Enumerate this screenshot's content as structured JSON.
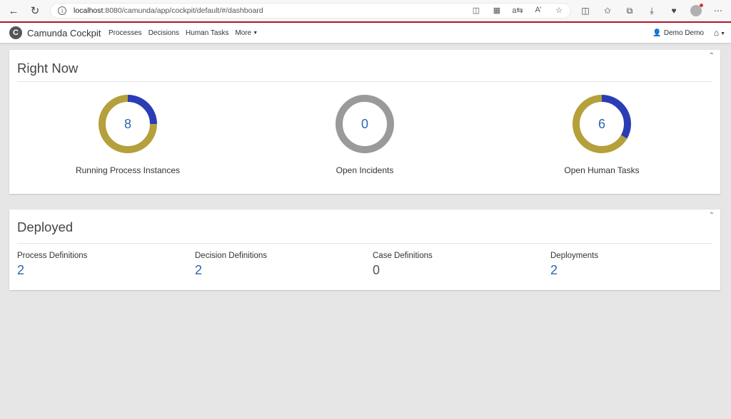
{
  "browser": {
    "url_host": "localhost",
    "url_path": ":8080/camunda/app/cockpit/default/#/dashboard",
    "icons": [
      "back-icon",
      "reload-icon",
      "info-icon",
      "app-available-icon",
      "qr-code-icon",
      "read-aloud-translate-icon",
      "read-aloud-icon",
      "favorite-star-icon",
      "split-screen-icon",
      "favorites-icon",
      "collections-icon",
      "downloads-icon",
      "extensions-icon",
      "profile-icon",
      "more-icon"
    ]
  },
  "header": {
    "brand": "Camunda Cockpit",
    "nav": [
      "Processes",
      "Decisions",
      "Human Tasks",
      "More"
    ],
    "user": "Demo Demo"
  },
  "right_now": {
    "title": "Right Now",
    "metrics": [
      {
        "label": "Running Process Instances",
        "value": "8",
        "segments": [
          {
            "fraction": 0.25,
            "color": "#2a3db5"
          },
          {
            "fraction": 0.75,
            "color": "#b5a03c"
          }
        ]
      },
      {
        "label": "Open Incidents",
        "value": "0",
        "segments": [
          {
            "fraction": 1.0,
            "color": "#9a9a9a"
          }
        ]
      },
      {
        "label": "Open Human Tasks",
        "value": "6",
        "segments": [
          {
            "fraction": 0.3333,
            "color": "#2a3db5"
          },
          {
            "fraction": 0.6667,
            "color": "#b5a03c"
          }
        ]
      }
    ]
  },
  "deployed": {
    "title": "Deployed",
    "items": [
      {
        "label": "Process Definitions",
        "count": "2"
      },
      {
        "label": "Decision Definitions",
        "count": "2"
      },
      {
        "label": "Case Definitions",
        "count": "0"
      },
      {
        "label": "Deployments",
        "count": "2"
      }
    ]
  },
  "colors": {
    "accent_bar": "#b5152b",
    "link": "#2f64ad",
    "background": "#e6e6e6"
  }
}
